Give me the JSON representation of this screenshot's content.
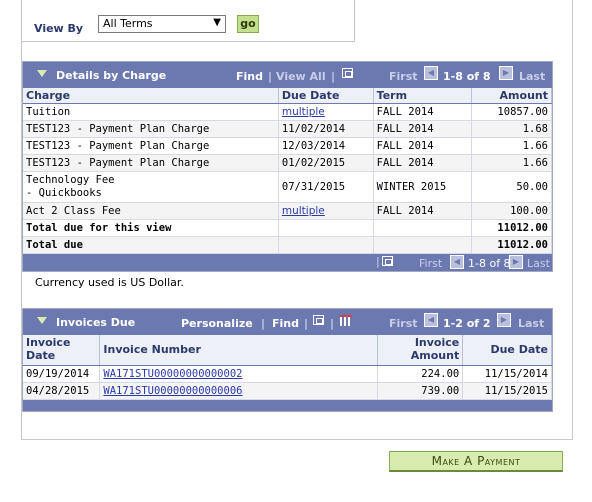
{
  "view_by": {
    "label": "View By",
    "selected": "All Terms",
    "go_label": "go"
  },
  "details": {
    "title": "Details by Charge",
    "find": "Find",
    "sep": "|",
    "view_all": "View All",
    "first": "First",
    "range": "1-8 of 8",
    "last": "Last",
    "columns": [
      "Charge",
      "Due Date",
      "Term",
      "Amount"
    ],
    "rows": [
      {
        "charge": "Tuition",
        "due": "multiple",
        "term": "FALL 2014",
        "amount": "10857.00"
      },
      {
        "charge": "TEST123 - Payment Plan Charge",
        "due": "11/02/2014",
        "term": "FALL 2014",
        "amount": "1.68"
      },
      {
        "charge": "TEST123 - Payment Plan Charge",
        "due": "12/03/2014",
        "term": "FALL 2014",
        "amount": "1.66"
      },
      {
        "charge": "TEST123 - Payment Plan Charge",
        "due": "01/02/2015",
        "term": "FALL 2014",
        "amount": "1.66"
      },
      {
        "charge": "Technology Fee",
        "charge2": "-  Quickbooks",
        "due": "07/31/2015",
        "term": "WINTER 2015",
        "amount": "50.00"
      },
      {
        "charge": "Act 2 Class Fee",
        "due": "multiple",
        "term": "FALL 2014",
        "amount": "100.00"
      }
    ],
    "total_view_label": "Total due for this view",
    "total_view_amount": "11012.00",
    "total_label": "Total due",
    "total_amount": "11012.00",
    "footer_first": "First",
    "footer_range": "1-8 of 8",
    "footer_last": "Last"
  },
  "currency_note": "Currency used is US Dollar.",
  "invoices": {
    "title": "Invoices Due",
    "personalize": "Personalize",
    "find": "Find",
    "sep": "|",
    "first": "First",
    "range": "1-2 of 2",
    "last": "Last",
    "col_date_1": "Invoice",
    "col_date_2": "Date",
    "col_number": "Invoice Number",
    "col_amount_1": "Invoice",
    "col_amount_2": "Amount",
    "col_due": "Due Date",
    "rows": [
      {
        "date": "09/19/2014",
        "number": "WA171STU00000000000002",
        "amount": "224.00",
        "due": "11/15/2014"
      },
      {
        "date": "04/28/2015",
        "number": "WA171STU00000000000006",
        "amount": "739.00",
        "due": "11/15/2015"
      }
    ]
  },
  "make_payment_label": "Make A Payment"
}
